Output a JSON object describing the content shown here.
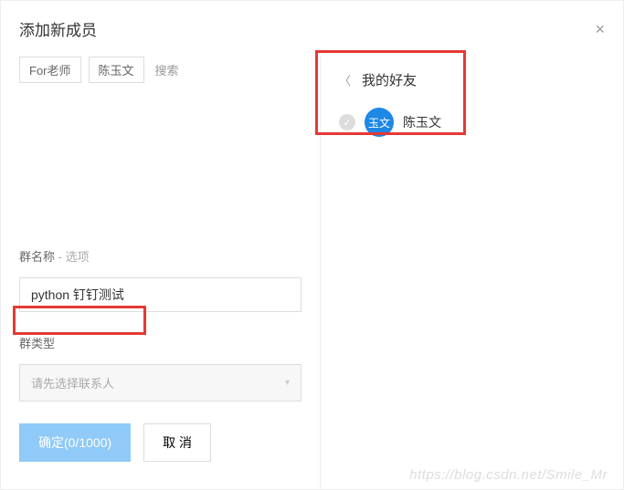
{
  "modal": {
    "title": "添加新成员",
    "close": "×"
  },
  "search": {
    "tag1": "For老师",
    "tag2": "陈玉文",
    "placeholder": "搜索"
  },
  "groupName": {
    "label": "群名称",
    "optional": " - 选项",
    "value": "python 钉钉测试"
  },
  "groupType": {
    "label": "群类型",
    "placeholder": "请先选择联系人"
  },
  "buttons": {
    "confirm": "确定(0/1000)",
    "cancel": "取 消"
  },
  "friends": {
    "title": "我的好友",
    "item": {
      "avatar": "玉文",
      "name": "陈玉文",
      "check": "✓"
    }
  },
  "watermark": "https://blog.csdn.net/Smile_Mr"
}
